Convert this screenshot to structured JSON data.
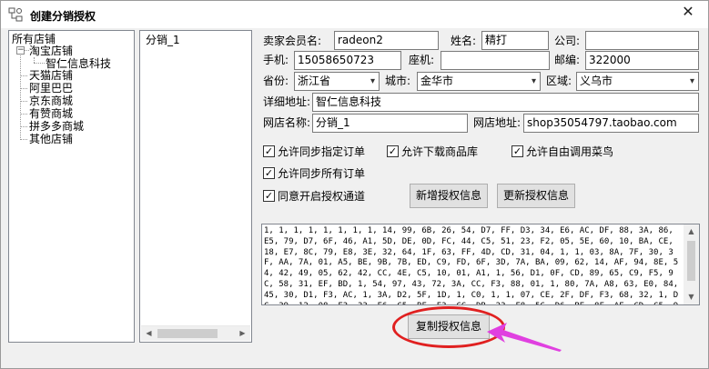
{
  "window": {
    "title": "创建分销授权",
    "close_glyph": "✕"
  },
  "tree": {
    "root": "所有店铺",
    "items": [
      {
        "label": "淘宝店铺",
        "expander": "−"
      },
      {
        "label": "智仁信息科技"
      },
      {
        "label": "天猫店铺"
      },
      {
        "label": "阿里巴巴"
      },
      {
        "label": "京东商城"
      },
      {
        "label": "有赞商城"
      },
      {
        "label": "拼多多商城"
      },
      {
        "label": "其他店铺"
      }
    ]
  },
  "shop_list": {
    "items": [
      "分销_1"
    ]
  },
  "form": {
    "seller_member_label": "卖家会员名:",
    "seller_member_value": "radeon2",
    "name_label": "姓名:",
    "name_value": "精打",
    "company_label": "公司:",
    "company_value": "",
    "mobile_label": "手机:",
    "mobile_value": "15058650723",
    "phone_label": "座机:",
    "phone_value": "",
    "zip_label": "邮编:",
    "zip_value": "322000",
    "province_label": "省份:",
    "province_value": "浙江省",
    "city_label": "城市:",
    "city_value": "金华市",
    "district_label": "区域:",
    "district_value": "义乌市",
    "address_label": "详细地址:",
    "address_value": "智仁信息科技",
    "shop_name_label": "网店名称:",
    "shop_name_value": "分销_1",
    "shop_url_label": "网店地址:",
    "shop_url_value": "shop35054797.taobao.com"
  },
  "options": [
    {
      "label": "允许同步指定订单",
      "checked": true
    },
    {
      "label": "允许下载商品库",
      "checked": true
    },
    {
      "label": "允许自由调用菜鸟",
      "checked": true
    },
    {
      "label": "允许同步所有订单",
      "checked": true
    },
    {
      "label": "同意开启授权通道",
      "checked": true
    }
  ],
  "buttons": {
    "add_auth": "新增授权信息",
    "update_auth": "更新授权信息",
    "copy_auth": "复制授权信息"
  },
  "auth_code": "1, 1, 1, 1, 1, 1, 1, 1, 14, 99, 6B, 26, 54, D7, FF, D3, 34, E6, AC, DF, 88, 3A, 86, E5, 79, D7, 6F, 46, A1, 5D, DE, 0D, FC, 44, C5, 51, 23, F2, 05, 5E, 60, 10, BA, CE, 18, E7, 8C, 79, E8, 3E, 32, 64, 1F, 63, FF, 4D, CD, 31, 04, 1, 1, 03, 8A, 7F, 30, 3F, AA, 7A, 01, A5, BE, 9B, 7B, ED, C9, FD, 6F, 3D, 7A, BA, 09, 62, 14, AF, 94, 8E, 54, 42, 49, 05, 62, 42, CC, 4E, C5, 10, 01, A1, 1, 56, D1, 0F, CD, 89, 65, C9, F5, 9C, 58, 31, EF, BD, 1, 54, 97, 43, 72, 3A, CC, F3, 88, 01, 1, 80, 7A, A8, 63, E0, 84, 45, 30, D1, F3, AC, 1, 3A, D2, 5F, 1D, 1, C0, 1, 1, 07, CE, 2F, DF, F3, 68, 32, 1, DC, 39, 12, 08, F3, 33, E6, C5, BF, F3, CC, DB, 23, F8, 5C, D6, BE, 8F, AF, CD, C5, 95, 53, 00, 40, 7A, 9A, C3, C6, AD, CC, 36, F",
  "colors": {
    "highlight": "#e02020",
    "pointer_arrow": "#e040e0"
  }
}
